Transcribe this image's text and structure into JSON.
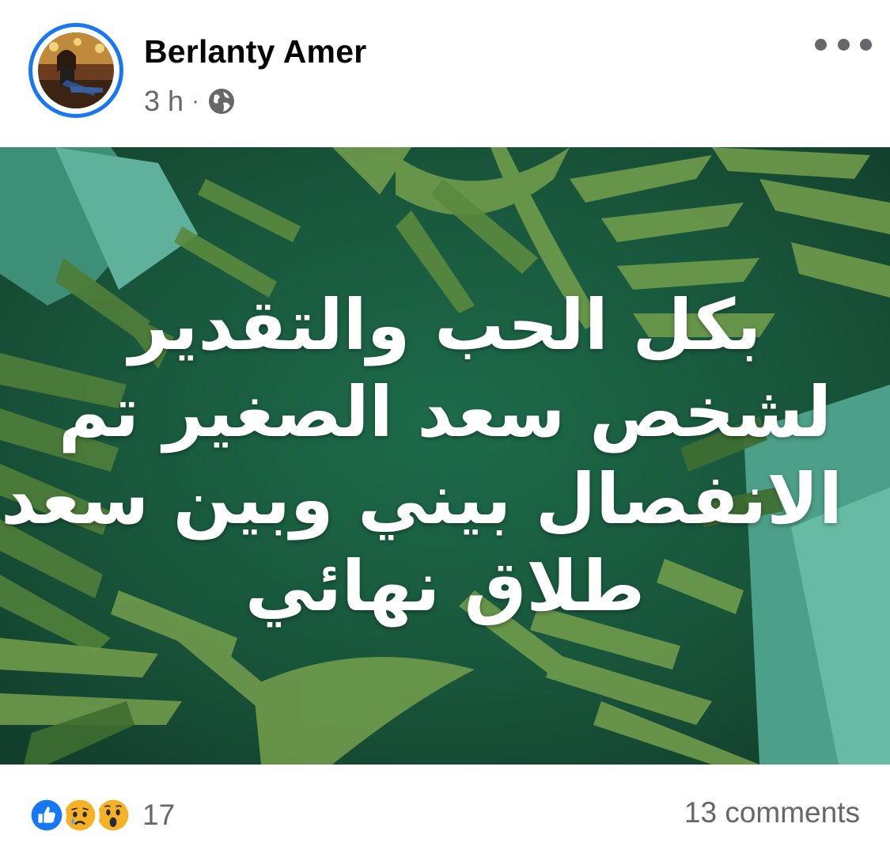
{
  "post": {
    "author": "Berlanty Amer",
    "time": "3 h",
    "separator": "·",
    "audience_icon": "globe-icon",
    "more_icon": "more-horizontal-icon",
    "image_text_lines": [
      "بكل الحب والتقدير",
      "لشخص سعد الصغير تم",
      "الانفصال بيني وبين سعد",
      "طلاق نهائي"
    ],
    "reactions": {
      "icons": [
        "like-icon",
        "sad-icon",
        "wow-icon"
      ],
      "count": "17"
    },
    "comments": "13 comments"
  },
  "colors": {
    "like_blue": "#1877f2",
    "secondary_text": "#65676b",
    "primary_text": "#050505"
  }
}
